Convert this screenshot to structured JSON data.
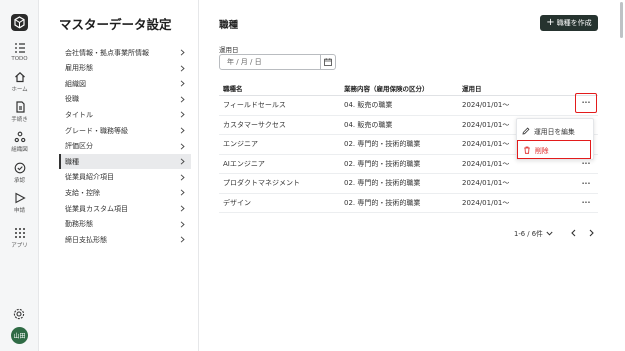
{
  "rail": {
    "items": [
      {
        "label": "TODO",
        "icon": "todo-list-icon"
      },
      {
        "label": "ホーム",
        "icon": "home-icon"
      },
      {
        "label": "手続き",
        "icon": "document-icon"
      },
      {
        "label": "組織図",
        "icon": "org-chart-icon"
      },
      {
        "label": "承認",
        "icon": "check-circle-icon"
      },
      {
        "label": "申請",
        "icon": "send-icon"
      },
      {
        "label": "アプリ",
        "icon": "apps-grid-icon"
      }
    ],
    "avatar_text": "山田"
  },
  "settings": {
    "title": "マスターデータ設定",
    "menu": [
      {
        "label": "会社情報・拠点事業所情報",
        "active": false
      },
      {
        "label": "雇用形態",
        "active": false
      },
      {
        "label": "組織図",
        "active": false
      },
      {
        "label": "役職",
        "active": false
      },
      {
        "label": "タイトル",
        "active": false
      },
      {
        "label": "グレード・職務等級",
        "active": false
      },
      {
        "label": "評価区分",
        "active": false
      },
      {
        "label": "職種",
        "active": true
      },
      {
        "label": "従業員紹介項目",
        "active": false
      },
      {
        "label": "支給・控除",
        "active": false
      },
      {
        "label": "従業員カスタム項目",
        "active": false
      },
      {
        "label": "勤務形態",
        "active": false
      },
      {
        "label": "締日支払形態",
        "active": false
      }
    ]
  },
  "main": {
    "title": "職種",
    "create_button": "職種を作成",
    "date_label": "運用日",
    "date_placeholder": "年 / 月 / 日",
    "table": {
      "headers": [
        "職種名",
        "業務内容（雇用保険の区分）",
        "運用日"
      ],
      "rows": [
        [
          "フィールドセールス",
          "04. 販売の職業",
          "2024/01/01〜"
        ],
        [
          "カスタマーサクセス",
          "04. 販売の職業",
          "2024/01/01〜"
        ],
        [
          "エンジニア",
          "02. 専門的・技術的職業",
          "2024/01/01〜"
        ],
        [
          "AIエンジニア",
          "02. 専門的・技術的職業",
          "2024/01/01〜"
        ],
        [
          "プロダクトマネジメント",
          "02. 専門的・技術的職業",
          "2024/01/01〜"
        ],
        [
          "デザイン",
          "02. 専門的・技術的職業",
          "2024/01/01〜"
        ]
      ]
    },
    "row_menu": {
      "edit": "運用日を編集",
      "delete": "削除"
    },
    "pagination": {
      "range": "1-6 / 6件"
    }
  },
  "colors": {
    "primary_button": "#26332f",
    "highlight": "#e31b1b",
    "danger": "#dd2222"
  }
}
